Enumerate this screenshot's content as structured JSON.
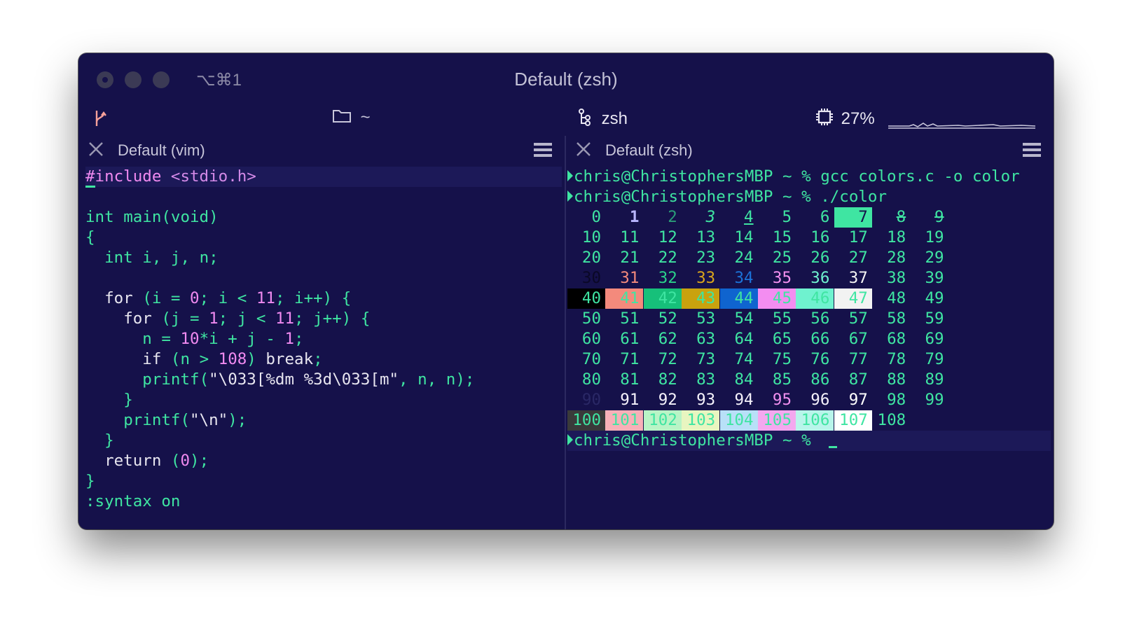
{
  "window": {
    "title": "Default (zsh)",
    "shortcut": "⌥⌘1"
  },
  "statusbar": {
    "git_icon": "git-branch-icon",
    "dir_icon": "folder-icon",
    "dir": "~",
    "shell_icon": "process-icon",
    "shell": "zsh",
    "cpu_icon": "cpu-icon",
    "cpu": "27%"
  },
  "panes": {
    "left": {
      "tab_title": "Default (vim)"
    },
    "right": {
      "tab_title": "Default (zsh)"
    }
  },
  "vim": {
    "lines": [
      "#include <stdio.h>",
      "",
      "int main(void)",
      "{",
      "  int i, j, n;",
      "",
      "  for (i = 0; i < 11; i++) {",
      "    for (j = 1; j < 11; j++) {",
      "      n = 10*i + j - 1;",
      "      if (n > 108) break;",
      "      printf(\"\\033[%dm %3d\\033[m\", n, n);",
      "    }",
      "    printf(\"\\n\");",
      "  }",
      "  return (0);",
      "}",
      ":syntax on"
    ]
  },
  "terminal": {
    "prompt_user": "chris@ChristophersMBP",
    "prompt_dir": "~",
    "prompt_symbol": "%",
    "commands": [
      "gcc colors.c -o color",
      "./color"
    ],
    "grid_rows": [
      [
        "0",
        "1",
        "2",
        "3",
        "4",
        "5",
        "6",
        "7",
        "8",
        "9"
      ],
      [
        "10",
        "11",
        "12",
        "13",
        "14",
        "15",
        "16",
        "17",
        "18",
        "19"
      ],
      [
        "20",
        "21",
        "22",
        "23",
        "24",
        "25",
        "26",
        "27",
        "28",
        "29"
      ],
      [
        "30",
        "31",
        "32",
        "33",
        "34",
        "35",
        "36",
        "37",
        "38",
        "39"
      ],
      [
        "40",
        "41",
        "42",
        "43",
        "44",
        "45",
        "46",
        "47",
        "48",
        "49"
      ],
      [
        "50",
        "51",
        "52",
        "53",
        "54",
        "55",
        "56",
        "57",
        "58",
        "59"
      ],
      [
        "60",
        "61",
        "62",
        "63",
        "64",
        "65",
        "66",
        "67",
        "68",
        "69"
      ],
      [
        "70",
        "71",
        "72",
        "73",
        "74",
        "75",
        "76",
        "77",
        "78",
        "79"
      ],
      [
        "80",
        "81",
        "82",
        "83",
        "84",
        "85",
        "86",
        "87",
        "88",
        "89"
      ],
      [
        "90",
        "91",
        "92",
        "93",
        "94",
        "95",
        "96",
        "97",
        "98",
        "99"
      ],
      [
        "100",
        "101",
        "102",
        "103",
        "104",
        "105",
        "106",
        "107",
        "108"
      ]
    ],
    "colors": {
      "default_fg": "#3fe5a2",
      "fg_30_37": [
        "#0a0826",
        "#f48a7c",
        "#2ad18a",
        "#d9a41c",
        "#1b72d8",
        "#f590f0",
        "#6ff2cf",
        "#f4f4f4"
      ],
      "bg_40_47": [
        "#000000",
        "#f48a7c",
        "#16c07a",
        "#c9a20e",
        "#0f64cf",
        "#f38df1",
        "#6ff2cf",
        "#f2f2f2"
      ],
      "fg_90_97": [
        "#2a2866",
        "#f5f2fb",
        "#f5f2fb",
        "#f5f2fb",
        "#f5f2fb",
        "#f290f0",
        "#f5f2fb",
        "#ffffff"
      ],
      "bg_100_107": [
        "#3a3a3a",
        "#f8b0b8",
        "#b9f4c6",
        "#e8f5c0",
        "#b8e0f8",
        "#f4a8ef",
        "#b8f5ea",
        "#ffffff"
      ]
    }
  }
}
